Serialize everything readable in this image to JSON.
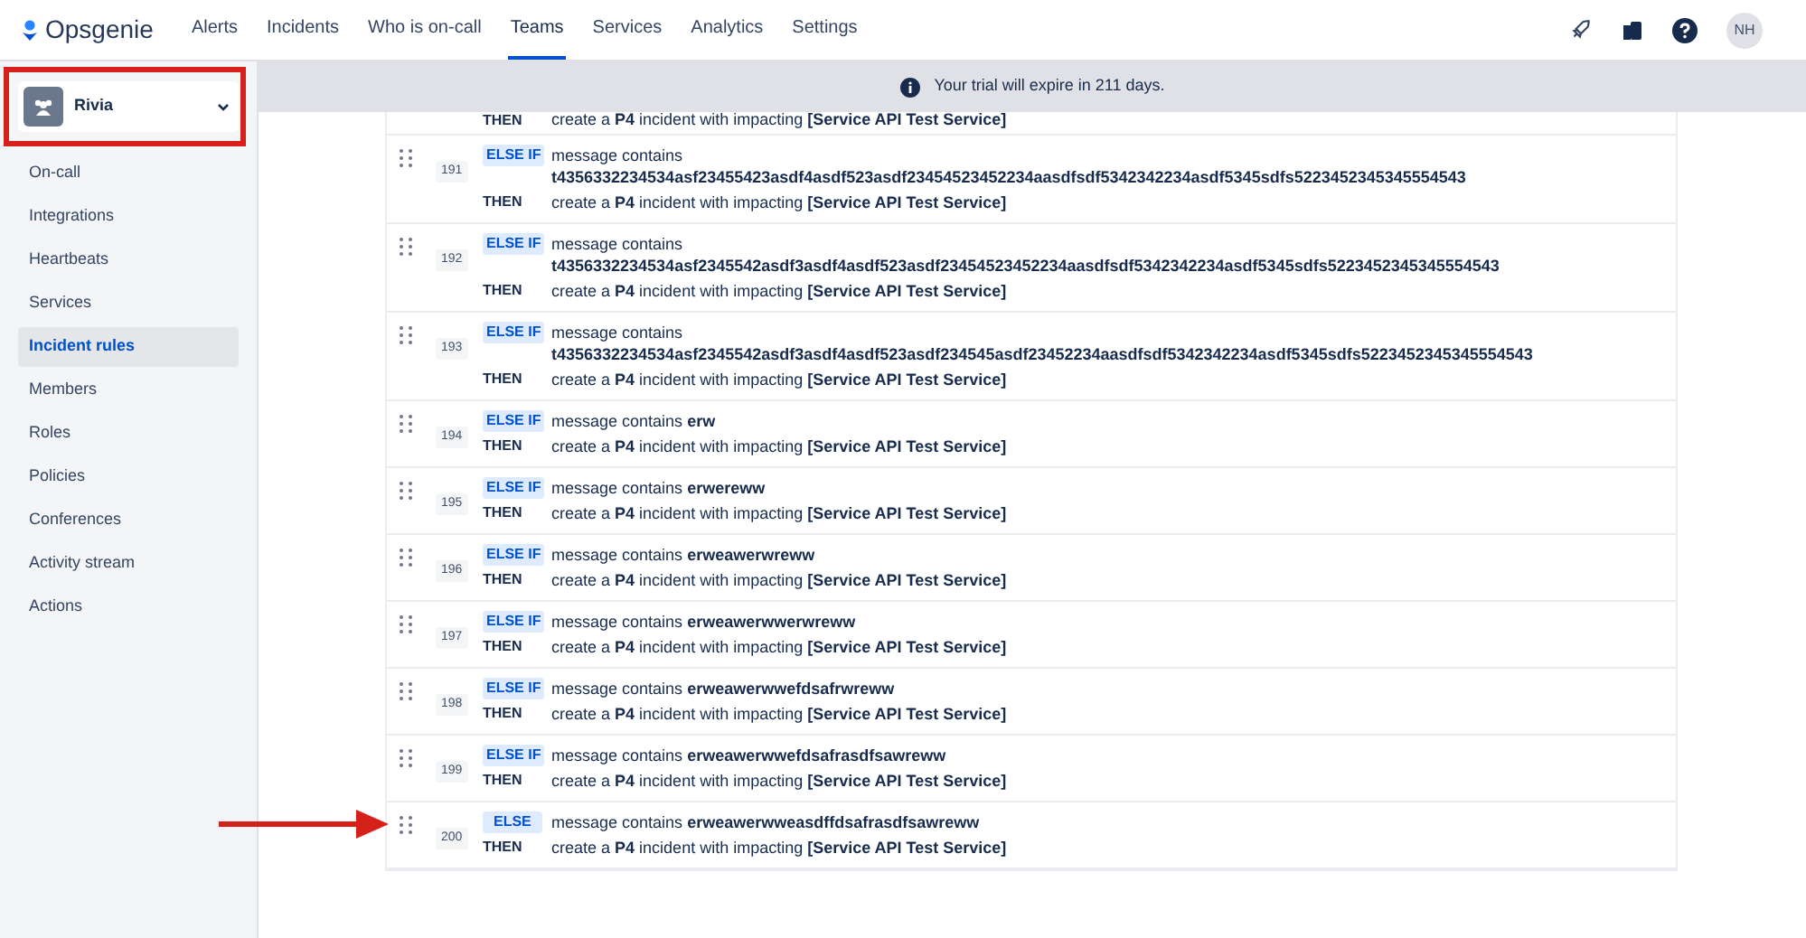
{
  "nav": {
    "logo": "Opsgenie",
    "items": [
      {
        "label": "Alerts",
        "selected": false
      },
      {
        "label": "Incidents",
        "selected": false
      },
      {
        "label": "Who is on-call",
        "selected": false
      },
      {
        "label": "Teams",
        "selected": true
      },
      {
        "label": "Services",
        "selected": false
      },
      {
        "label": "Analytics",
        "selected": false
      },
      {
        "label": "Settings",
        "selected": false
      }
    ],
    "avatar": "NH"
  },
  "sidebar": {
    "team": "Rivia",
    "items": [
      {
        "label": "On-call",
        "selected": false
      },
      {
        "label": "Integrations",
        "selected": false
      },
      {
        "label": "Heartbeats",
        "selected": false
      },
      {
        "label": "Services",
        "selected": false
      },
      {
        "label": "Incident rules",
        "selected": true
      },
      {
        "label": "Members",
        "selected": false
      },
      {
        "label": "Roles",
        "selected": false
      },
      {
        "label": "Policies",
        "selected": false
      },
      {
        "label": "Conferences",
        "selected": false
      },
      {
        "label": "Activity stream",
        "selected": false
      },
      {
        "label": "Actions",
        "selected": false
      }
    ]
  },
  "banner": "Your trial will expire in 211 days.",
  "partial_row": {
    "then_label": "THEN",
    "then": "create a **P4** incident with impacting **[Service API Test Service]**"
  },
  "rules": [
    {
      "number": "191",
      "condition": "ELSE IF",
      "message_label": "message contains",
      "value": "t4356332234534asf23455423asdf4asdf523asdf23454523452234aasdfsdf5342342234asdf5345sdfs5223452345345554543",
      "then_label": "THEN",
      "then": "create a **P4** incident with impacting **[Service API Test Service]**",
      "highlighted": false
    },
    {
      "number": "192",
      "condition": "ELSE IF",
      "message_label": "message contains",
      "value": "t4356332234534asf2345542asdf3asdf4asdf523asdf23454523452234aasdfsdf5342342234asdf5345sdfs5223452345345554543",
      "then_label": "THEN",
      "then": "create a **P4** incident with impacting **[Service API Test Service]**",
      "highlighted": false
    },
    {
      "number": "193",
      "condition": "ELSE IF",
      "message_label": "message contains",
      "value": "t4356332234534asf2345542asdf3asdf4asdf523asdf234545asdf23452234aasdfsdf5342342234asdf5345sdfs5223452345345554543",
      "then_label": "THEN",
      "then": "create a **P4** incident with impacting **[Service API Test Service]**",
      "highlighted": false
    },
    {
      "number": "194",
      "condition": "ELSE IF",
      "message_label": "message contains",
      "value": "erw",
      "then_label": "THEN",
      "then": "create a **P4** incident with impacting **[Service API Test Service]**",
      "highlighted": false
    },
    {
      "number": "195",
      "condition": "ELSE IF",
      "message_label": "message contains",
      "value": "erwereww",
      "then_label": "THEN",
      "then": "create a **P4** incident with impacting **[Service API Test Service]**",
      "highlighted": false
    },
    {
      "number": "196",
      "condition": "ELSE IF",
      "message_label": "message contains",
      "value": "erweawerwreww",
      "then_label": "THEN",
      "then": "create a **P4** incident with impacting **[Service API Test Service]**",
      "highlighted": false
    },
    {
      "number": "197",
      "condition": "ELSE IF",
      "message_label": "message contains",
      "value": "erweawerwwerwreww",
      "then_label": "THEN",
      "then": "create a **P4** incident with impacting **[Service API Test Service]**",
      "highlighted": false
    },
    {
      "number": "198",
      "condition": "ELSE IF",
      "message_label": "message contains",
      "value": "erweawerwwefdsafrwreww",
      "then_label": "THEN",
      "then": "create a **P4** incident with impacting **[Service API Test Service]**",
      "highlighted": false
    },
    {
      "number": "199",
      "condition": "ELSE IF",
      "message_label": "message contains",
      "value": "erweawerwwefdsafrasdfsawreww",
      "then_label": "THEN",
      "then": "create a **P4** incident with impacting **[Service API Test Service]**",
      "highlighted": false
    },
    {
      "number": "200",
      "condition": "ELSE",
      "message_label": "message contains",
      "value": "erweawerwweasdffdsafrasdfsawreww",
      "then_label": "THEN",
      "then": "create a **P4** incident with impacting **[Service API Test Service]**",
      "highlighted": true
    }
  ]
}
